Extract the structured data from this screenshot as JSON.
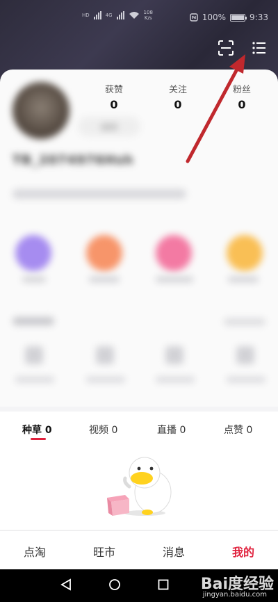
{
  "status_bar": {
    "left_speed_value": "108",
    "left_speed_unit": "K/s",
    "network_label_1": "HD",
    "network_label_2": "4G",
    "battery": "100%",
    "time": "9:33"
  },
  "profile": {
    "stats": [
      {
        "label": "获赞",
        "value": "0"
      },
      {
        "label": "关注",
        "value": "0"
      },
      {
        "label": "粉丝",
        "value": "0"
      }
    ],
    "edit_label": "编辑",
    "username": "TB_2074976Hsh"
  },
  "content_tabs": [
    {
      "label": "种草",
      "count": "0"
    },
    {
      "label": "视频",
      "count": "0"
    },
    {
      "label": "直播",
      "count": "0"
    },
    {
      "label": "点赞",
      "count": "0"
    }
  ],
  "bottom_nav": [
    {
      "label": "点淘"
    },
    {
      "label": "旺市"
    },
    {
      "label": "消息"
    },
    {
      "label": "我的"
    }
  ],
  "watermark": {
    "brand": "Bai度经验",
    "url": "jingyan.baidu.com"
  },
  "icons": {
    "scan": "scan-icon",
    "menu": "menu-icon",
    "back": "back-triangle-icon",
    "home": "home-circle-icon",
    "recent": "recent-square-icon"
  },
  "colors": {
    "accent": "#e0213d",
    "header": "#2e2c3c",
    "annotation_arrow": "#c0282d"
  }
}
